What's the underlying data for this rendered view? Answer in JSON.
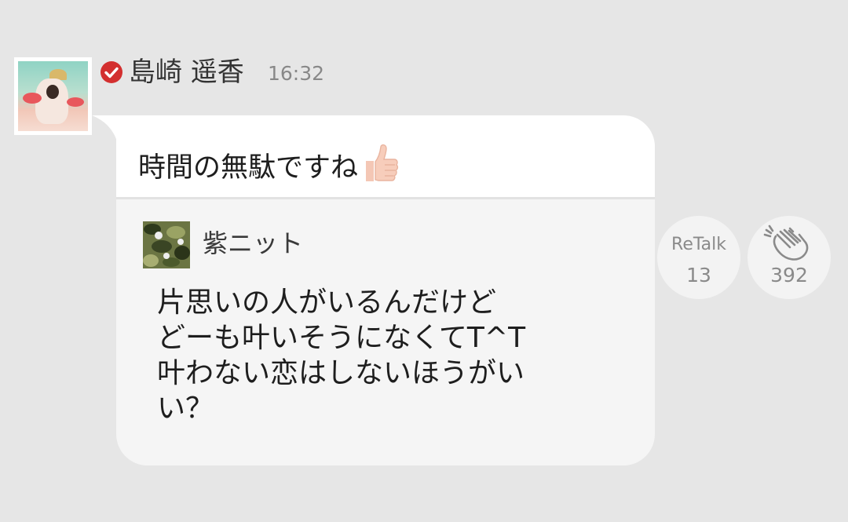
{
  "post": {
    "sender_name": "島崎 遥香",
    "timestamp": "16:32",
    "message": "時間の無駄ですね",
    "message_emoji": "thumbs-up-icon",
    "verified_badge": "check-circle-icon",
    "verified_color": "#d32f2f"
  },
  "quoted": {
    "author": "紫ニット",
    "lines": [
      "片思いの人がいるんだけど",
      "どーも叶いそうになくてT^T",
      "叶わない恋はしないほうがい",
      "い？"
    ]
  },
  "actions": {
    "retalk_label": "ReTalk",
    "retalk_count": "13",
    "clap_icon": "clapping-hands-icon",
    "clap_count": "392"
  },
  "colors": {
    "background": "#e6e6e6",
    "bubble": "#f5f5f5",
    "bubble_top": "#ffffff"
  }
}
